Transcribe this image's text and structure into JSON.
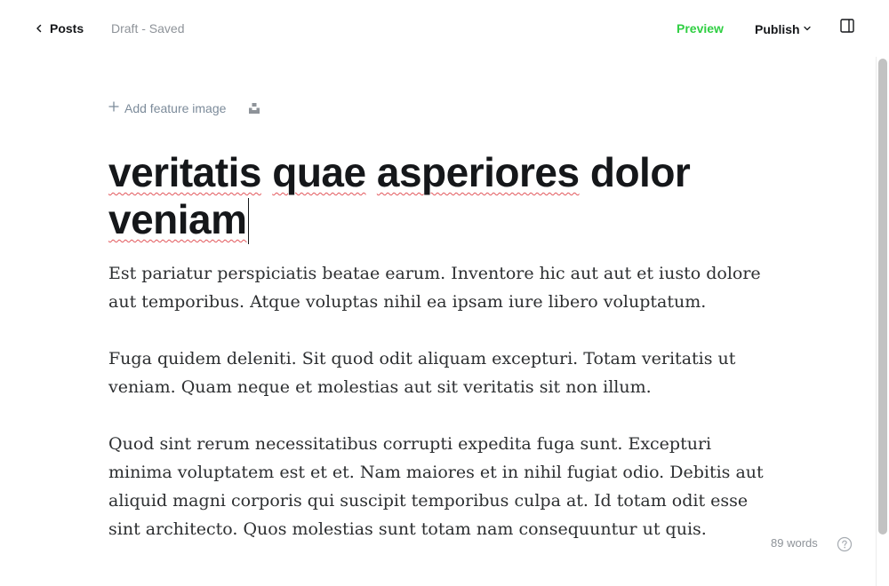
{
  "header": {
    "back_label": "Posts",
    "status": "Draft - Saved",
    "preview_label": "Preview",
    "publish_label": "Publish"
  },
  "editor": {
    "feature_image_label": "Add feature image",
    "title_words": [
      "veritatis",
      "quae",
      "asperiores",
      "dolor",
      "veniam"
    ],
    "paragraphs": [
      "Est pariatur perspiciatis beatae earum. Inventore hic aut aut et iusto dolore aut temporibus. Atque voluptas nihil ea ipsam iure libero voluptatum.",
      "Fuga quidem deleniti. Sit quod odit aliquam excepturi. Totam veritatis ut veniam. Quam neque et molestias aut sit veritatis sit non illum.",
      "Quod sint rerum necessitatibus corrupti expedita fuga sunt. Excepturi minima voluptatem est et et. Nam maiores et in nihil fugiat odio. Debitis aut aliquid magni corporis qui suscipit temporibus culpa at. Id totam odit esse sint architecto. Quos molestias sunt totam nam consequuntur ut quis."
    ]
  },
  "footer": {
    "word_count": "89 words"
  },
  "icons": {
    "back": "chevron-left-icon",
    "publish_dropdown": "chevron-down-icon",
    "sidebar_toggle": "sidebar-panel-icon",
    "add": "plus-icon",
    "unsplash": "unsplash-icon",
    "help": "question-circle-icon"
  },
  "colors": {
    "preview": "#30cf43",
    "spellcheck": "#e2575b",
    "muted": "#8e9399"
  }
}
